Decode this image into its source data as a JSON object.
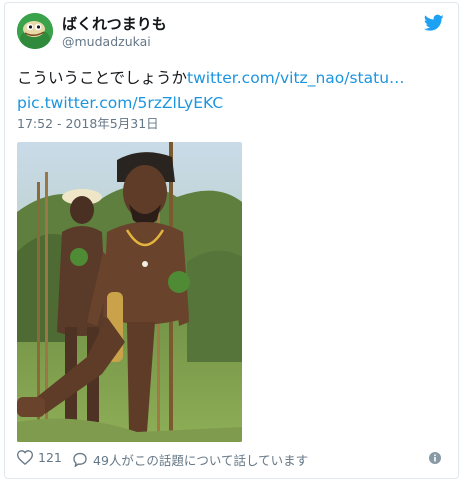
{
  "author": {
    "display_name": "ばくれつまりも",
    "handle": "@mudadzukai"
  },
  "icons": {
    "brand": "twitter-bird-icon",
    "like": "heart-icon",
    "reply": "speech-bubble-icon",
    "info": "info-icon"
  },
  "tweet": {
    "text": "こういうことでしょうか",
    "link_text": "twitter.com/vitz_nao/statu…",
    "media_link_text": "pic.twitter.com/5rzZlLyEKC",
    "timestamp": "17:52 - 2018年5月31日"
  },
  "footer": {
    "like_count": "121",
    "discussion_text": "49人がこの話題について話しています"
  },
  "colors": {
    "link": "#1b95e0",
    "brand": "#1da1f2",
    "secondary_text": "#657786"
  }
}
